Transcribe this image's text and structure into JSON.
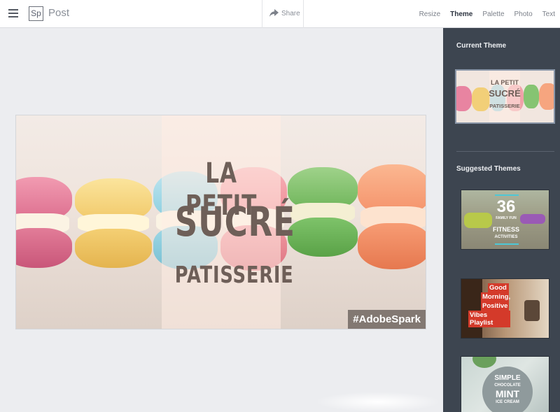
{
  "app": {
    "logo": "Sp",
    "title": "Post"
  },
  "toolbar": {
    "share_label": "Share"
  },
  "nav": {
    "tabs": [
      "Resize",
      "Theme",
      "Palette",
      "Photo",
      "Text"
    ],
    "active": "Theme"
  },
  "poster": {
    "line1": "LA PETIT",
    "line2": "SUCRÉ",
    "line3": "PATISSERIE",
    "hashtag": "#AdobeSpark"
  },
  "sidebar": {
    "current_heading": "Current Theme",
    "suggested_heading": "Suggested Themes",
    "current_thumb": {
      "line1": "LA PETIT",
      "line2": "SUCRÉ",
      "line3": "PATISSERIE"
    },
    "suggested": [
      {
        "big": "36",
        "small1": "FAMILY FUN",
        "small2": "FITNESS",
        "small3": "ACTIVITIES"
      },
      {
        "lines": [
          "Good",
          "Morning,",
          "Positive",
          "Vibes Playlist"
        ]
      },
      {
        "big": "SIMPLE",
        "small1": "CHOCOLATE",
        "big2": "MINT",
        "small2": "ICE CREAM"
      }
    ]
  },
  "colors": {
    "panel": "#3d4550",
    "accent_text": "#6e5f58",
    "topbar": "#ffffff",
    "canvas_bg": "#ecedf0"
  }
}
